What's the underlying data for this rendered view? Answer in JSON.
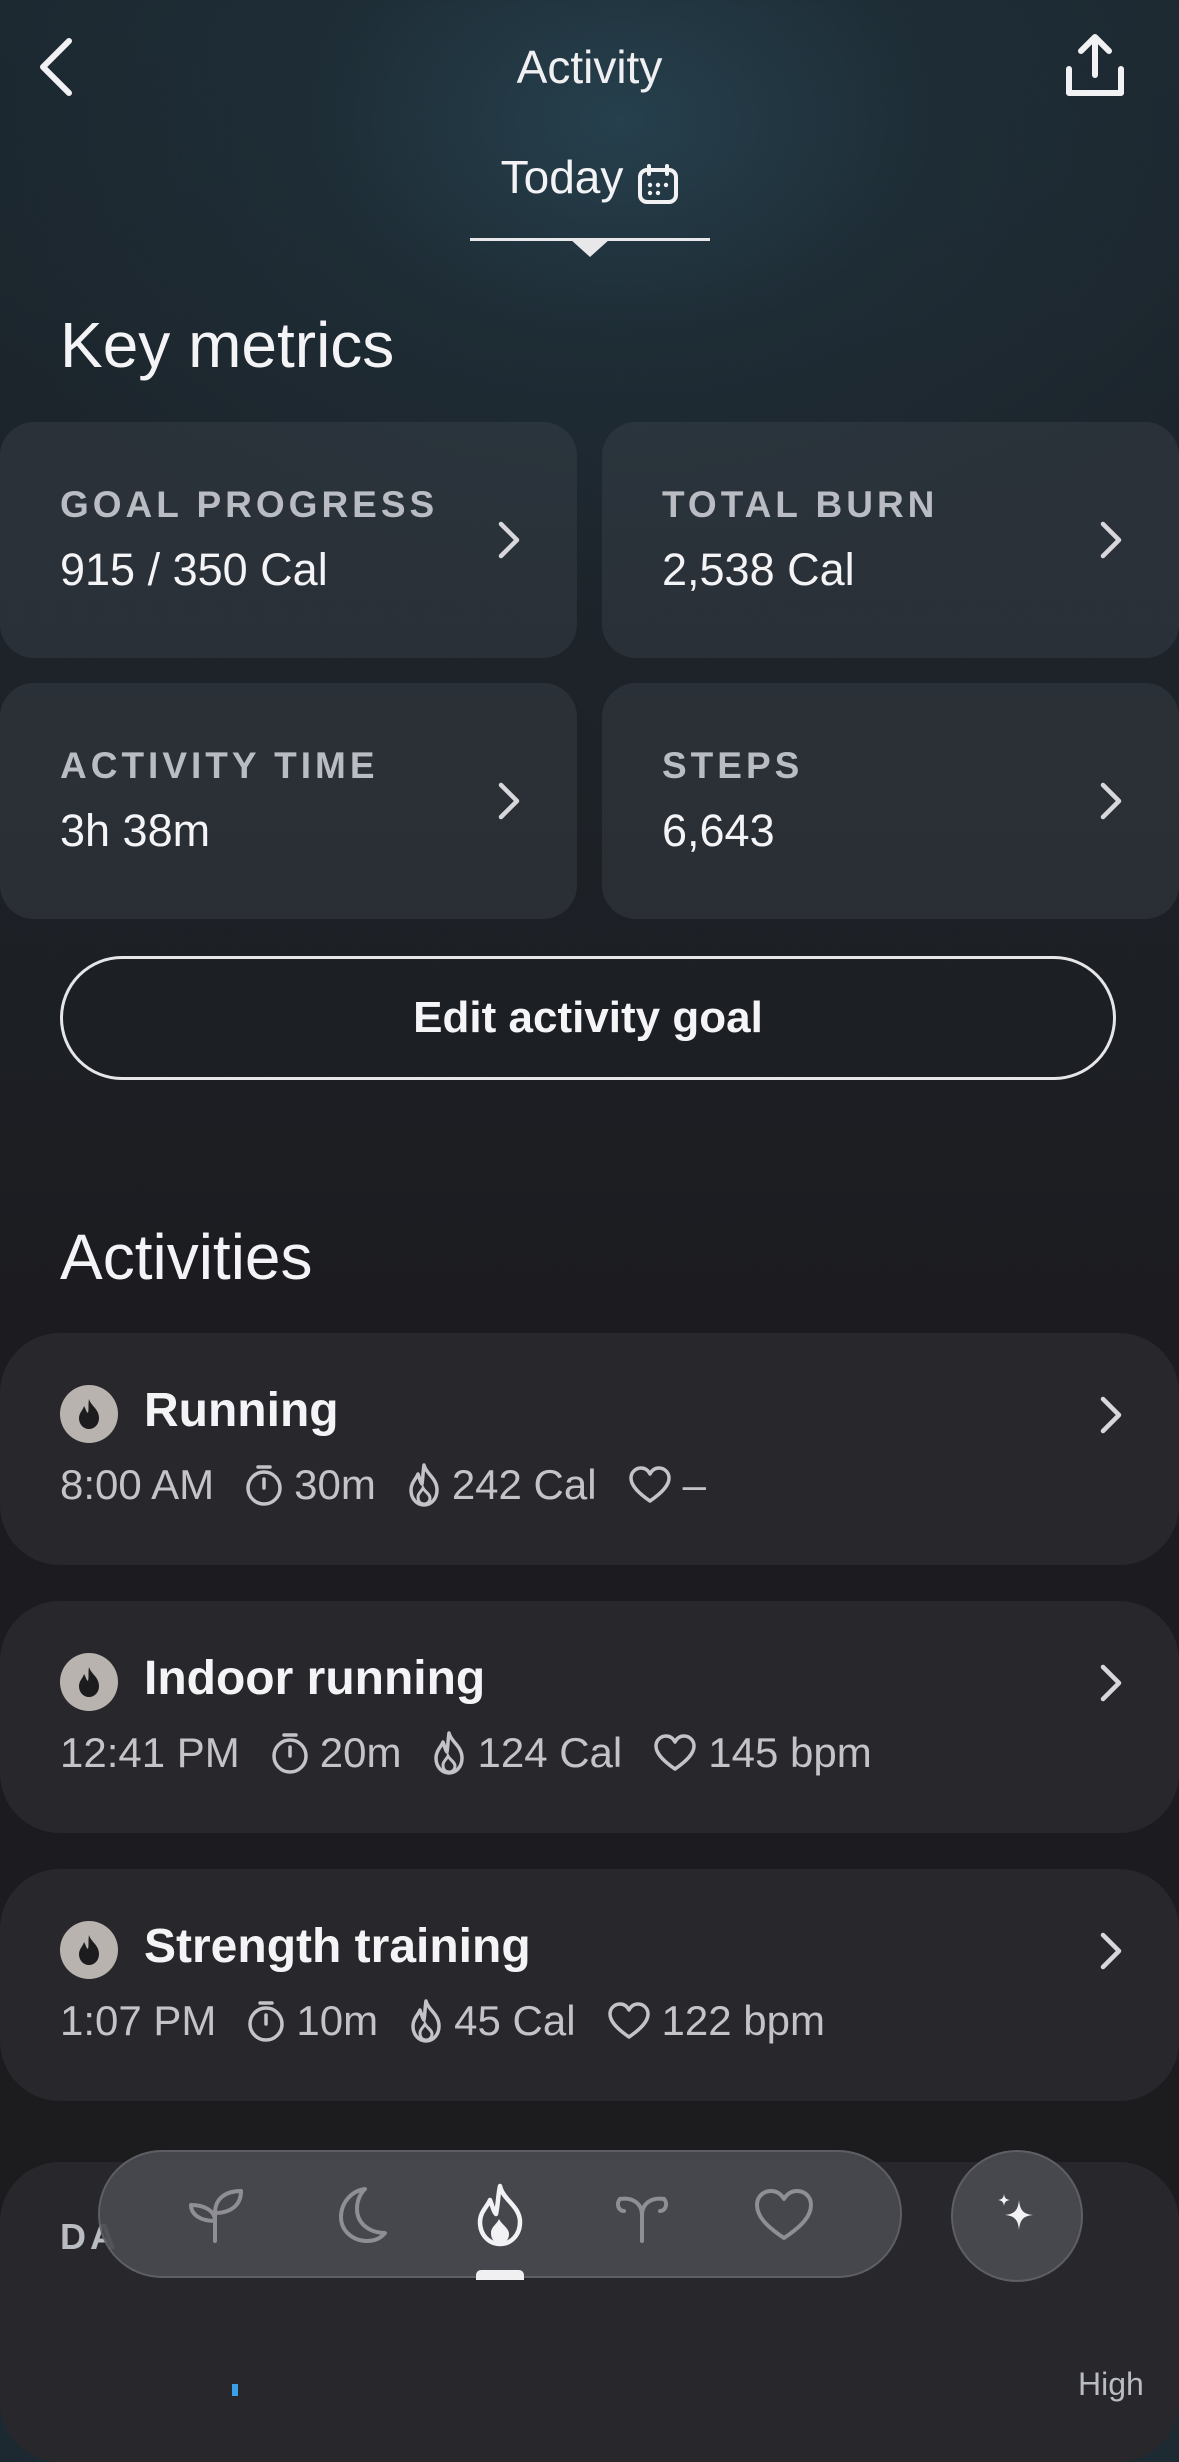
{
  "header": {
    "title": "Activity",
    "date_label": "Today"
  },
  "key_metrics": {
    "title": "Key metrics",
    "cards": [
      {
        "label": "GOAL PROGRESS",
        "value": "915 / 350 Cal"
      },
      {
        "label": "TOTAL BURN",
        "value": "2,538 Cal"
      },
      {
        "label": "ACTIVITY TIME",
        "value": "3h 38m"
      },
      {
        "label": "STEPS",
        "value": "6,643"
      }
    ],
    "edit_button": "Edit activity goal"
  },
  "activities": {
    "title": "Activities",
    "items": [
      {
        "name": "Running",
        "time": "8:00 AM",
        "duration": "30m",
        "calories": "242 Cal",
        "heart_rate": "–"
      },
      {
        "name": "Indoor running",
        "time": "12:41 PM",
        "duration": "20m",
        "calories": "124 Cal",
        "heart_rate": "145 bpm"
      },
      {
        "name": "Strength training",
        "time": "1:07 PM",
        "duration": "10m",
        "calories": "45 Cal",
        "heart_rate": "122 bpm"
      }
    ]
  },
  "partial_section": {
    "label": "DA",
    "right_label": "High"
  },
  "tabbar": {
    "items": [
      "readiness-icon",
      "sleep-icon",
      "activity-icon",
      "cycle-icon",
      "heart-icon"
    ],
    "active": "activity-icon"
  },
  "colors": {
    "card_bg": "#28282c",
    "accent_blue": "#3aa0e8",
    "badge": "#b9b3b0"
  }
}
